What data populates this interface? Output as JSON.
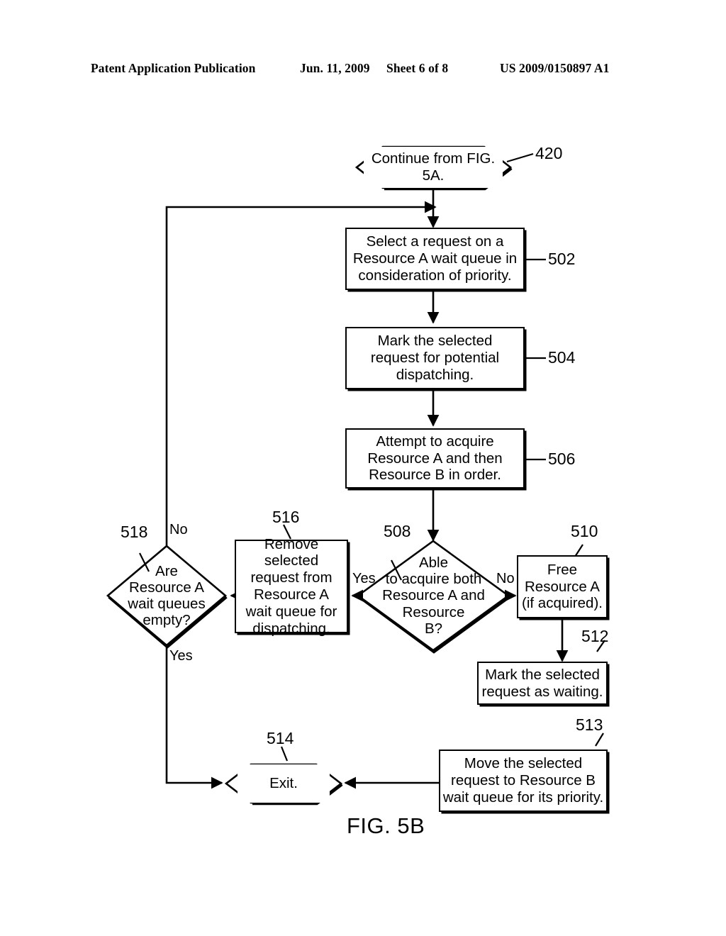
{
  "header": {
    "publication": "Patent Application Publication",
    "date": "Jun. 11, 2009",
    "sheet": "Sheet 6 of 8",
    "patent_number": "US 2009/0150897 A1"
  },
  "figure": {
    "caption": "FIG. 5B"
  },
  "nodes": {
    "n420": {
      "ref": "420",
      "text": "Continue from FIG.\n5A.",
      "shape": "hexagon"
    },
    "n502": {
      "ref": "502",
      "text": "Select a request on a\nResource A wait queue in\nconsideration of priority.",
      "shape": "process"
    },
    "n504": {
      "ref": "504",
      "text": "Mark the selected\nrequest for potential\ndispatching.",
      "shape": "process"
    },
    "n506": {
      "ref": "506",
      "text": "Attempt to acquire\nResource A and then\nResource B in order.",
      "shape": "process"
    },
    "n508": {
      "ref": "508",
      "text": "Able\nto acquire both\nResource A and\nResource\nB?",
      "shape": "decision"
    },
    "n510": {
      "ref": "510",
      "text": "Free\nResource A\n(if acquired).",
      "shape": "process"
    },
    "n512": {
      "ref": "512",
      "text": "Mark the selected\nrequest as waiting.",
      "shape": "process"
    },
    "n513": {
      "ref": "513",
      "text": "Move the selected\nrequest to Resource B\nwait queue for its priority.",
      "shape": "process"
    },
    "n514": {
      "ref": "514",
      "text": "Exit.",
      "shape": "hexagon"
    },
    "n516": {
      "ref": "516",
      "text": "Remove selected\nrequest from\nResource A\nwait queue for\ndispatching.",
      "shape": "process"
    },
    "n518": {
      "ref": "518",
      "text": "Are\nResource A\nwait queues\nempty?",
      "shape": "decision"
    }
  },
  "edge_labels": {
    "yes_508": "Yes",
    "no_508": "No",
    "no_518": "No",
    "yes_518": "Yes"
  },
  "colors": {
    "ink": "#000000",
    "paper": "#ffffff"
  }
}
